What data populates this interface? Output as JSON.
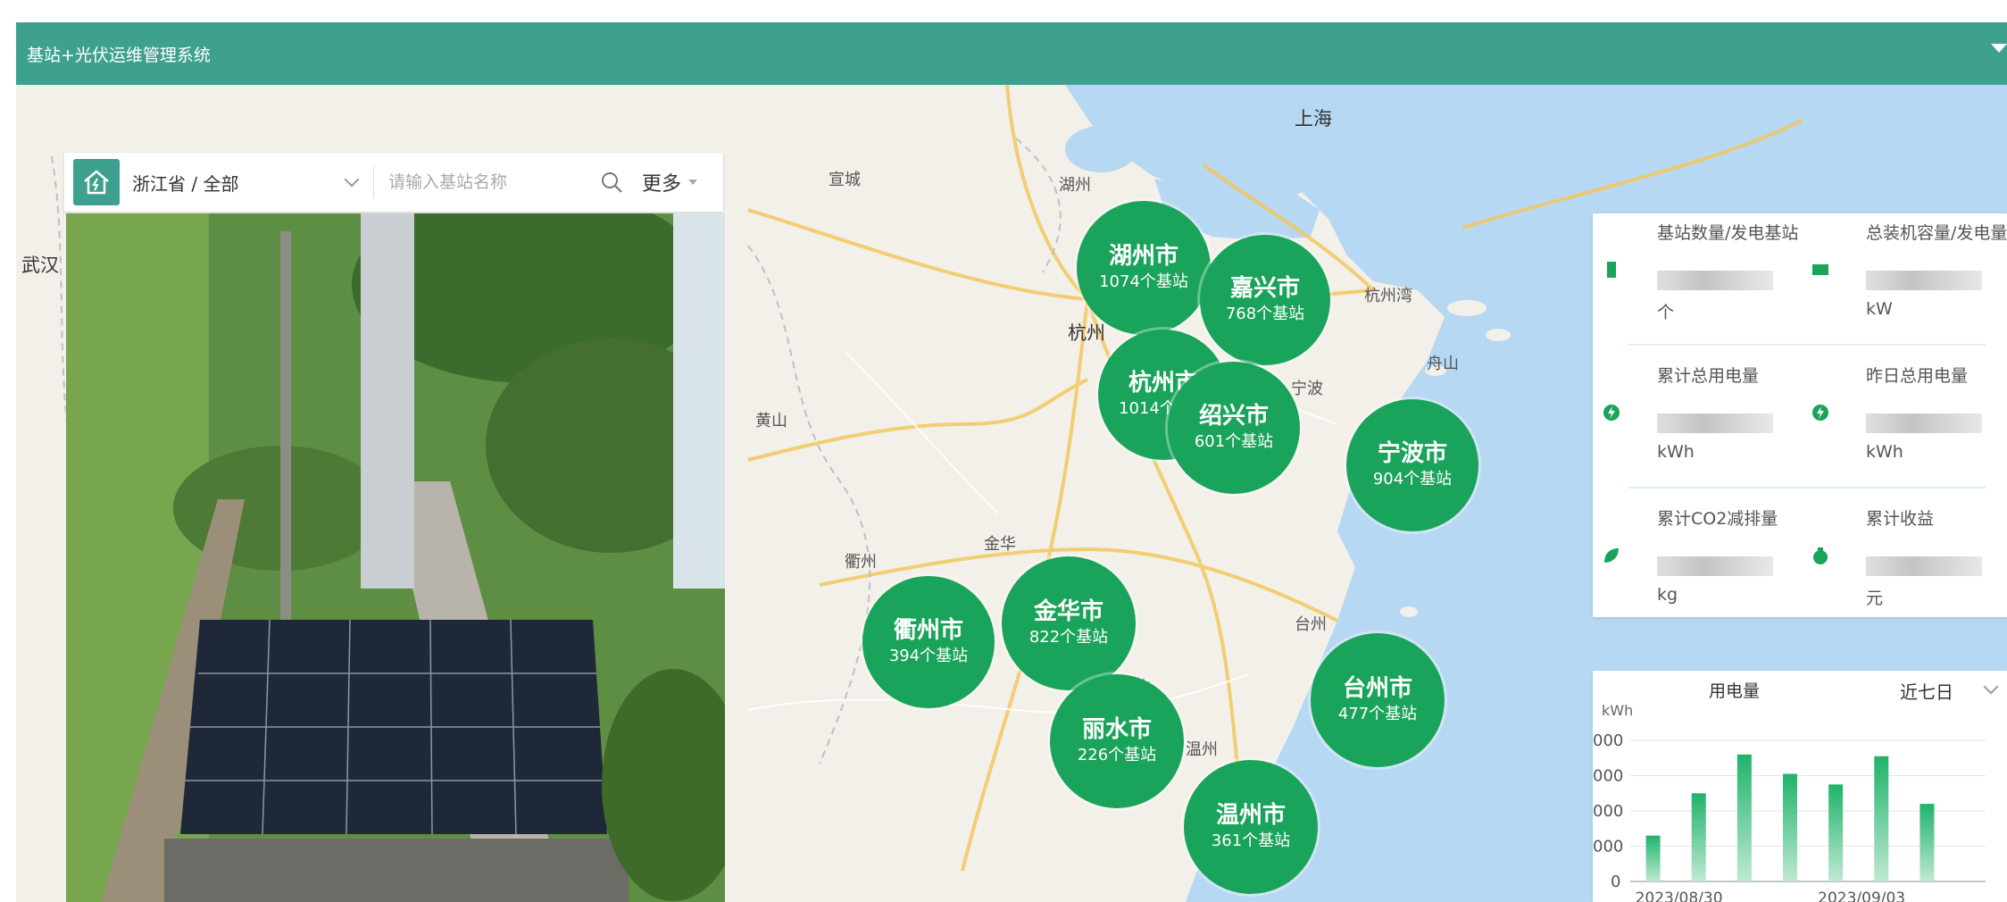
{
  "header": {
    "title": "基站+光伏运维管理系统"
  },
  "search": {
    "region_value": "浙江省 / 全部",
    "placeholder": "请输入基站名称",
    "more_label": "更多"
  },
  "map_labels": [
    "上海",
    "宣城",
    "湖州",
    "杭州",
    "杭州湾",
    "宁波",
    "舟山",
    "黄山",
    "衢州",
    "金华",
    "台州",
    "温州",
    "丽水",
    "武汉"
  ],
  "clusters": [
    {
      "name": "湖州市",
      "count": "1074个基站"
    },
    {
      "name": "嘉兴市",
      "count": "768个基站"
    },
    {
      "name": "杭州市",
      "count": "1014个基站"
    },
    {
      "name": "绍兴市",
      "count": "601个基站"
    },
    {
      "name": "宁波市",
      "count": "904个基站"
    },
    {
      "name": "衢州市",
      "count": "394个基站"
    },
    {
      "name": "金华市",
      "count": "822个基站"
    },
    {
      "name": "丽水市",
      "count": "226个基站"
    },
    {
      "name": "台州市",
      "count": "477个基站"
    },
    {
      "name": "温州市",
      "count": "361个基站"
    }
  ],
  "stats": [
    {
      "label": "基站数量/发电基站",
      "unit": "个",
      "icon": "station-icon"
    },
    {
      "label": "总装机容量/发电量",
      "unit": "kW",
      "icon": "capacity-icon"
    },
    {
      "label": "累计总用电量",
      "unit": "kWh",
      "icon": "energy-icon"
    },
    {
      "label": "昨日总用电量",
      "unit": "kWh",
      "icon": "energy-icon"
    },
    {
      "label": "累计CO2减排量",
      "unit": "kg",
      "icon": "leaf-icon"
    },
    {
      "label": "累计收益",
      "unit": "元",
      "icon": "money-bag-icon"
    }
  ],
  "chart_data": {
    "type": "bar",
    "title": "用电量",
    "ylabel": "kWh",
    "period": "近七日",
    "categories": [
      "2023/08/30",
      "2023/08/31",
      "2023/09/01",
      "2023/09/02",
      "2023/09/03",
      "2023/09/04",
      "2023/09/05"
    ],
    "values": [
      1300,
      2500,
      3600,
      3050,
      2750,
      3550,
      2200
    ],
    "ylim": [
      0,
      4000
    ],
    "yticks": [
      "0",
      "000",
      "000",
      "000",
      "000"
    ],
    "xtick_labels": [
      "2023/08/30",
      "2023/09/03"
    ]
  },
  "colors": {
    "header": "#3ea08f",
    "cluster": "#1aa35a",
    "sea": "#b7d8f2",
    "bar": "#1fb36a"
  }
}
